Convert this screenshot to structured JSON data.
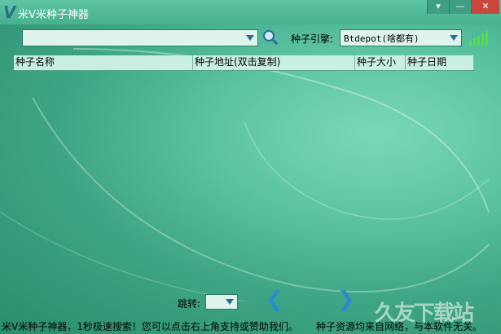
{
  "app": {
    "title": "米V米种子神器",
    "logo": "V"
  },
  "window_controls": {
    "menu": "▾",
    "minimize": "—",
    "close": "✕"
  },
  "search": {
    "value": ""
  },
  "engine": {
    "label": "种子引擎:",
    "value": "Btdepot(啥都有)"
  },
  "columns": [
    "种子名称",
    "种子地址(双击复制)",
    "种子大小",
    "种子日期"
  ],
  "pager": {
    "label": "跳转:",
    "prev": "❮",
    "next": "❯",
    "value": ""
  },
  "status": {
    "left": "米V米种子神器，1秒极速搜索！您可以点击右上角支持或赞助我们。",
    "right": "种子资源均来自网络，与本软件无关。"
  },
  "watermark": "久友下载站",
  "colors": {
    "accent": "#2a8bd0",
    "signal": "#56e040"
  }
}
